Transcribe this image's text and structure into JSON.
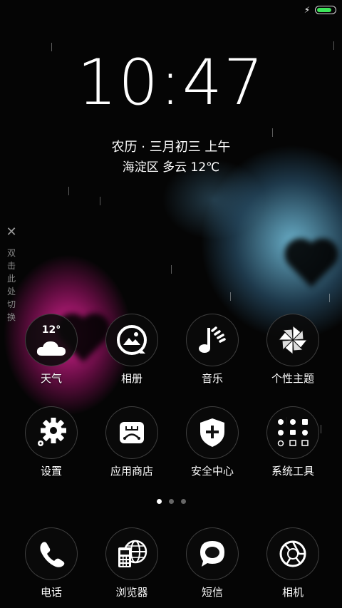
{
  "status_bar": {
    "charging_icon": "bolt-icon",
    "battery_level": 0.85,
    "battery_color": "#3ce65a"
  },
  "lockscreen": {
    "time": "10:47",
    "lunar_date": "农历 · 三月初三  上午",
    "weather_line": "海淀区  多云  12℃"
  },
  "toggle_hint": {
    "close_glyph": "✕",
    "chars": [
      "双",
      "击",
      "此",
      "处",
      "切",
      "换"
    ]
  },
  "apps": {
    "weather": {
      "label": "天气",
      "temp": "12°"
    },
    "gallery": {
      "label": "相册"
    },
    "music": {
      "label": "音乐"
    },
    "themes": {
      "label": "个性主题"
    },
    "settings": {
      "label": "设置"
    },
    "app_store": {
      "label": "应用商店"
    },
    "security": {
      "label": "安全中心"
    },
    "tools": {
      "label": "系统工具"
    }
  },
  "page_indicator": {
    "count": 3,
    "active": 0
  },
  "dock": {
    "phone": {
      "label": "电话"
    },
    "browser": {
      "label": "浏览器"
    },
    "messages": {
      "label": "短信"
    },
    "camera": {
      "label": "相机"
    }
  }
}
